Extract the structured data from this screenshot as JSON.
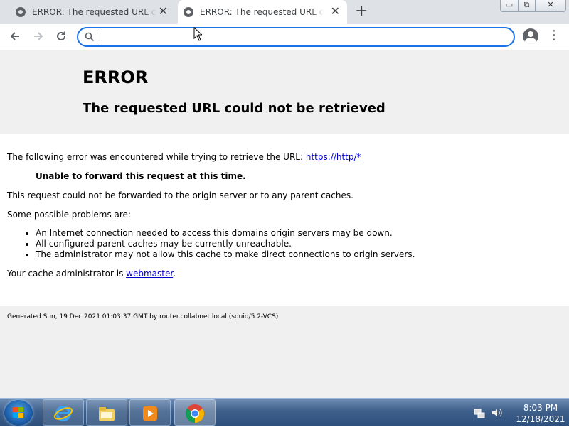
{
  "browser": {
    "tabs": [
      {
        "title": "ERROR: The requested URL could not be retrieved",
        "active": false
      },
      {
        "title": "ERROR: The requested URL could not be retrieved",
        "active": true
      }
    ],
    "new_tab_symbol": "+",
    "close_symbol": "✕",
    "address_value": "",
    "window_buttons": {
      "minimize": "▭",
      "maximize": "⧉",
      "close": "✕"
    }
  },
  "page": {
    "title": "ERROR",
    "subtitle": "The requested URL could not be retrieved",
    "intro_text": "The following error was encountered while trying to retrieve the URL:",
    "url_link": "https://http/*",
    "error_reason": "Unable to forward this request at this time.",
    "explanation": "This request could not be forwarded to the origin server or to any parent caches.",
    "problems_heading": "Some possible problems are:",
    "problems": [
      "An Internet connection needed to access this domains origin servers may be down.",
      "All configured parent caches may be currently unreachable.",
      "The administrator may not allow this cache to make direct connections to origin servers."
    ],
    "admin_text": "Your cache administrator is",
    "admin_link": "webmaster",
    "admin_suffix": ".",
    "footer": "Generated Sun, 19 Dec 2021 01:03:37 GMT by router.collabnet.local (squid/5.2-VCS)"
  },
  "taskbar": {
    "time": "8:03 PM",
    "date": "12/18/2021",
    "pinned": [
      "internet-explorer-icon",
      "windows-explorer-icon",
      "media-player-icon",
      "chrome-icon"
    ]
  },
  "colors": {
    "accent": "#1a73e8",
    "link": "#0000cc",
    "header_bg": "#f0f0f0"
  }
}
